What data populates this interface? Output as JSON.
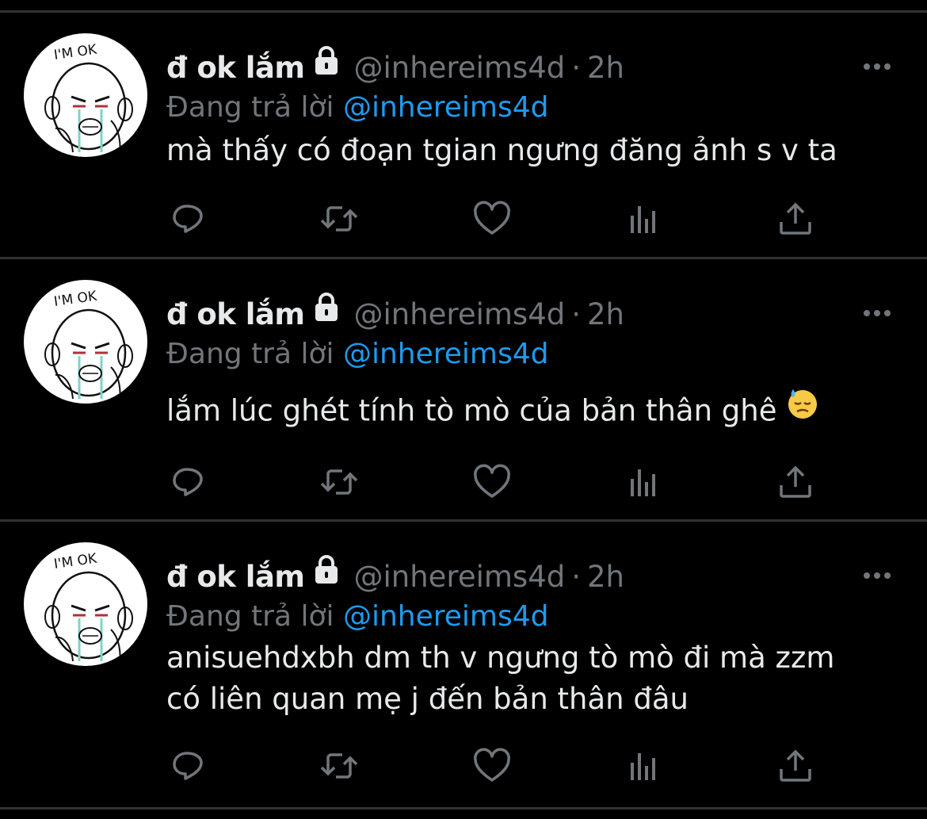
{
  "colors": {
    "background": "#000000",
    "divider": "#2f3336",
    "primary_text": "#e7e9ea",
    "secondary_text": "#71767b",
    "link": "#1d9bf0"
  },
  "tweets": [
    {
      "avatar_label": "I'M OK",
      "display_name": "đ ok lắm",
      "lock_icon": "lock-icon",
      "handle": "@inhereims4d",
      "separator": "·",
      "time": "2h",
      "reply_prefix": "Đang trả lời",
      "reply_to": "@inhereims4d",
      "text": "mà thấy có đoạn tgian ngưng đăng ảnh s v ta",
      "emoji": "",
      "actions": [
        "reply-icon",
        "retweet-icon",
        "like-icon",
        "analytics-icon",
        "share-icon"
      ]
    },
    {
      "avatar_label": "I'M OK",
      "display_name": "đ ok lắm",
      "lock_icon": "lock-icon",
      "handle": "@inhereims4d",
      "separator": "·",
      "time": "2h",
      "reply_prefix": "Đang trả lời",
      "reply_to": "@inhereims4d",
      "text": "lắm lúc ghét tính tò mò của bản thân ghê",
      "emoji": "downcast-face-with-sweat-emoji",
      "actions": [
        "reply-icon",
        "retweet-icon",
        "like-icon",
        "analytics-icon",
        "share-icon"
      ]
    },
    {
      "avatar_label": "I'M OK",
      "display_name": "đ ok lắm",
      "lock_icon": "lock-icon",
      "handle": "@inhereims4d",
      "separator": "·",
      "time": "2h",
      "reply_prefix": "Đang trả lời",
      "reply_to": "@inhereims4d",
      "text": "anisuehdxbh dm th v ngưng tò mò đi mà zzm\ncó liên quan mẹ j đến bản thân đâu",
      "emoji": "",
      "actions": [
        "reply-icon",
        "retweet-icon",
        "like-icon",
        "analytics-icon",
        "share-icon"
      ]
    }
  ]
}
